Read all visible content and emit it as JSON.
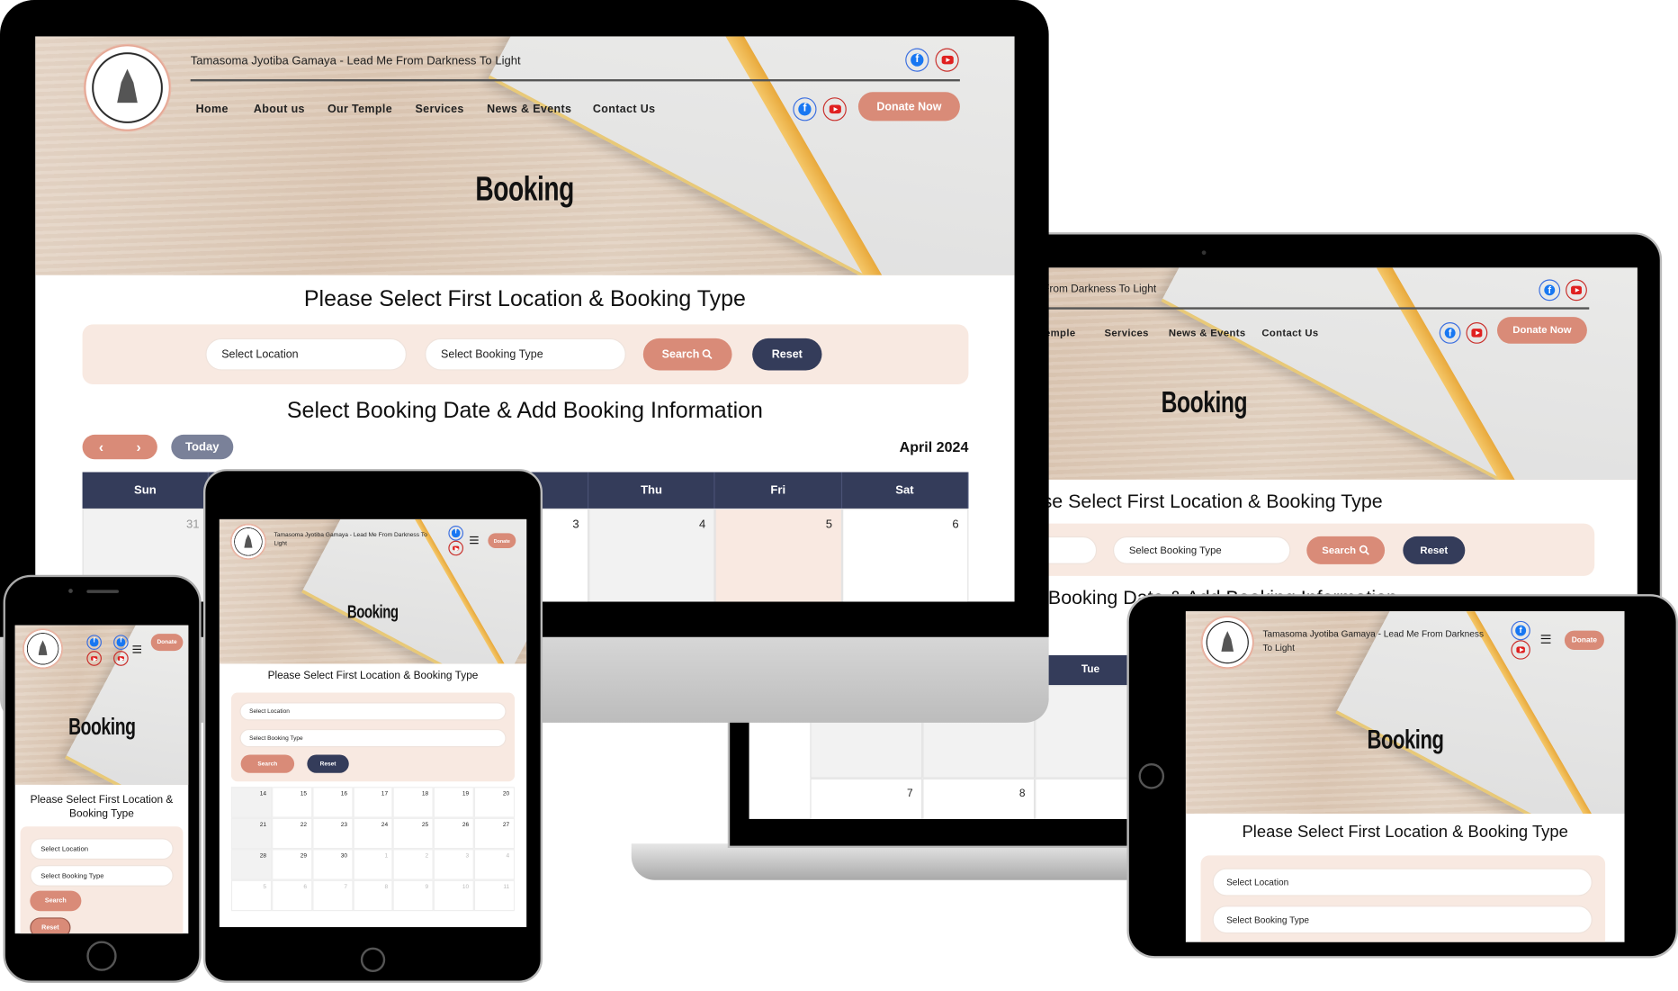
{
  "site": {
    "tagline": "Tamasoma Jyotiba Gamaya - Lead Me From Darkness To Light",
    "nav": [
      "Home",
      "About us",
      "Our Temple",
      "Services",
      "News & Events",
      "Contact Us"
    ],
    "donate": "Donate Now",
    "donate_short": "Donate",
    "page_title": "Booking",
    "heading_select": "Please Select First Location & Booking Type",
    "location_placeholder": "Select Location",
    "type_placeholder": "Select Booking Type",
    "search": "Search",
    "reset": "Reset",
    "heading_date": "Select Booking Date & Add Booking Information",
    "today": "Today",
    "month": "April 2024",
    "prev_icon": "chevron-left-icon",
    "next_icon": "chevron-right-icon",
    "weekdays": [
      "Sun",
      "",
      "",
      "",
      "Thu",
      "Fri",
      "Sat"
    ],
    "laptop_weekdays": [
      "",
      "",
      "Tue",
      "",
      "",
      "",
      ""
    ],
    "colors": {
      "accent": "#d98b78",
      "navy": "#343c5a",
      "panel": "#f8e9e1",
      "today_cell": "#f9e9e1",
      "past_cell": "#f2f2f2"
    }
  },
  "calendar": {
    "monitor_first_week": [
      "31",
      "",
      "",
      "3",
      "4",
      "5",
      "6"
    ],
    "laptop_second_week": [
      "7",
      "8",
      "",
      "",
      "",
      "",
      ""
    ],
    "tablet_weeks": [
      [
        "14",
        "15",
        "16",
        "17",
        "18",
        "19",
        "20"
      ],
      [
        "21",
        "22",
        "23",
        "24",
        "25",
        "26",
        "27"
      ],
      [
        "28",
        "29",
        "30",
        "1",
        "2",
        "3",
        "4"
      ],
      [
        "5",
        "6",
        "7",
        "8",
        "9",
        "10",
        "11"
      ]
    ]
  }
}
